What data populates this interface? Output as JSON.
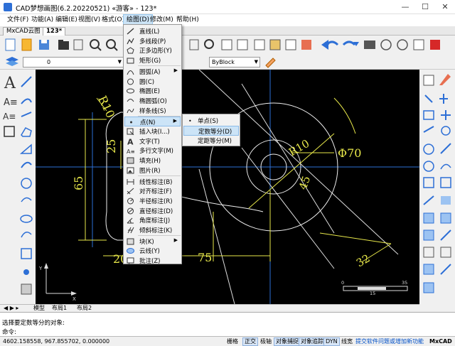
{
  "window": {
    "title": "CAD梦想画图(6.2.20220521) «游客» - 123*",
    "minimize": "—",
    "maximize": "☐",
    "close": "✕"
  },
  "menubar": [
    "文件(F)",
    "功能(A)",
    "编辑(E)",
    "视图(V)",
    "格式(O)",
    "绘图(D)",
    "修改(M)",
    "帮助(H)"
  ],
  "doc_tabs": [
    "MxCAD云图",
    "123*"
  ],
  "toolbar2": {
    "layer_value": "0",
    "linetype_value": "ByBlock"
  },
  "draw_menu": {
    "items": [
      {
        "label": "直线(L)",
        "icon": "line-icon"
      },
      {
        "label": "多线段(P)",
        "icon": "polyline-icon"
      },
      {
        "label": "正多边形(Y)",
        "icon": "polygon-icon"
      },
      {
        "label": "矩形(G)",
        "icon": "rectangle-icon"
      },
      {
        "label": "圆弧(A)",
        "icon": "arc-icon",
        "submenu": true
      },
      {
        "label": "圆(C)",
        "icon": "circle-icon"
      },
      {
        "label": "椭圆(E)",
        "icon": "ellipse-icon"
      },
      {
        "label": "椭圆弧(O)",
        "icon": "ellipse-arc-icon"
      },
      {
        "label": "样条线(S)",
        "icon": "spline-icon"
      },
      {
        "label": "点(N)",
        "icon": "point-icon",
        "submenu": true,
        "highlighted": true
      },
      {
        "label": "插入块(I...)",
        "icon": "insert-block-icon"
      },
      {
        "label": "文字(T)",
        "icon": "text-icon"
      },
      {
        "label": "多行文字(M)",
        "icon": "mtext-icon"
      },
      {
        "label": "填充(H)",
        "icon": "hatch-icon"
      },
      {
        "label": "图片(R)",
        "icon": "image-icon"
      },
      {
        "label": "线性标注(B)",
        "icon": "dim-linear-icon"
      },
      {
        "label": "对齐标注(F)",
        "icon": "dim-aligned-icon"
      },
      {
        "label": "半径标注(R)",
        "icon": "dim-radius-icon"
      },
      {
        "label": "直径标注(D)",
        "icon": "dim-diameter-icon"
      },
      {
        "label": "角度标注(J)",
        "icon": "dim-angle-icon"
      },
      {
        "label": "倾斜标注(K)",
        "icon": "dim-oblique-icon"
      },
      {
        "label": "块(K)",
        "icon": "block-icon",
        "submenu": true
      },
      {
        "label": "云线(Y)",
        "icon": "revcloud-icon"
      },
      {
        "label": "批注(Z)",
        "icon": "comment-icon"
      }
    ]
  },
  "point_submenu": {
    "items": [
      {
        "label": "单点(S)",
        "bullet": "•"
      },
      {
        "label": "定数等分(D)",
        "highlighted": true
      },
      {
        "label": "定距等分(M)"
      }
    ]
  },
  "drawing": {
    "dims": [
      "R10",
      "25",
      "65",
      "R10",
      "Φ70",
      "45",
      "20",
      "75",
      "32"
    ],
    "scale_labels": [
      "0",
      "15",
      "35"
    ]
  },
  "layout_tabs": [
    "模型",
    "布局1",
    "布局2"
  ],
  "command": {
    "history": "选择要定数等分的对象:",
    "prompt": "命令:"
  },
  "status": {
    "coords": "4602.158558,  967.855702,  0.000000",
    "toggles": [
      {
        "label": "栅格",
        "on": false
      },
      {
        "label": "正交",
        "on": true
      },
      {
        "label": "极轴",
        "on": false
      },
      {
        "label": "对象捕捉",
        "on": true
      },
      {
        "label": "对象追踪",
        "on": true
      },
      {
        "label": "DYN",
        "on": true
      },
      {
        "label": "线宽",
        "on": false
      }
    ],
    "feedback": "提交软件问题或增加新功能",
    "brand": "MxCAD"
  }
}
